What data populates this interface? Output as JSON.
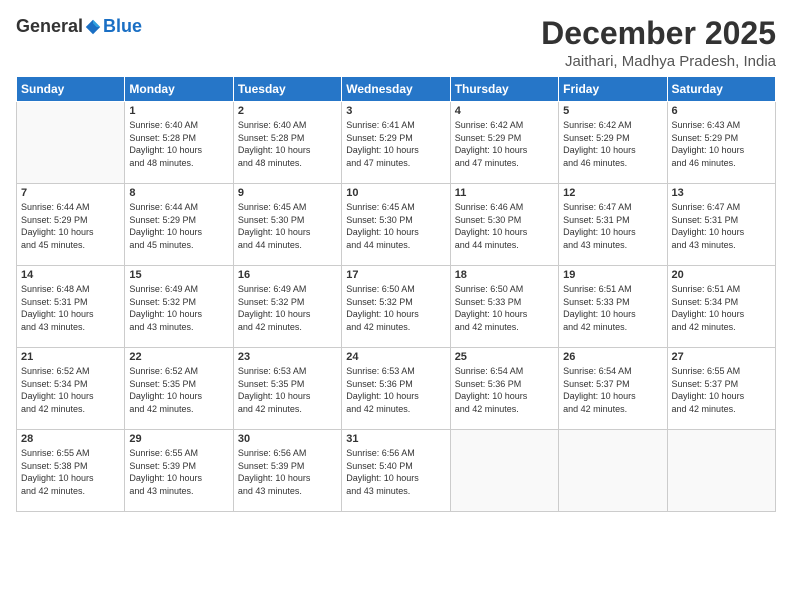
{
  "logo": {
    "general": "General",
    "blue": "Blue"
  },
  "header": {
    "month": "December 2025",
    "location": "Jaithari, Madhya Pradesh, India"
  },
  "days_of_week": [
    "Sunday",
    "Monday",
    "Tuesday",
    "Wednesday",
    "Thursday",
    "Friday",
    "Saturday"
  ],
  "weeks": [
    [
      {
        "day": "",
        "info": ""
      },
      {
        "day": "1",
        "info": "Sunrise: 6:40 AM\nSunset: 5:28 PM\nDaylight: 10 hours\nand 48 minutes."
      },
      {
        "day": "2",
        "info": "Sunrise: 6:40 AM\nSunset: 5:28 PM\nDaylight: 10 hours\nand 48 minutes."
      },
      {
        "day": "3",
        "info": "Sunrise: 6:41 AM\nSunset: 5:29 PM\nDaylight: 10 hours\nand 47 minutes."
      },
      {
        "day": "4",
        "info": "Sunrise: 6:42 AM\nSunset: 5:29 PM\nDaylight: 10 hours\nand 47 minutes."
      },
      {
        "day": "5",
        "info": "Sunrise: 6:42 AM\nSunset: 5:29 PM\nDaylight: 10 hours\nand 46 minutes."
      },
      {
        "day": "6",
        "info": "Sunrise: 6:43 AM\nSunset: 5:29 PM\nDaylight: 10 hours\nand 46 minutes."
      }
    ],
    [
      {
        "day": "7",
        "info": "Sunrise: 6:44 AM\nSunset: 5:29 PM\nDaylight: 10 hours\nand 45 minutes."
      },
      {
        "day": "8",
        "info": "Sunrise: 6:44 AM\nSunset: 5:29 PM\nDaylight: 10 hours\nand 45 minutes."
      },
      {
        "day": "9",
        "info": "Sunrise: 6:45 AM\nSunset: 5:30 PM\nDaylight: 10 hours\nand 44 minutes."
      },
      {
        "day": "10",
        "info": "Sunrise: 6:45 AM\nSunset: 5:30 PM\nDaylight: 10 hours\nand 44 minutes."
      },
      {
        "day": "11",
        "info": "Sunrise: 6:46 AM\nSunset: 5:30 PM\nDaylight: 10 hours\nand 44 minutes."
      },
      {
        "day": "12",
        "info": "Sunrise: 6:47 AM\nSunset: 5:31 PM\nDaylight: 10 hours\nand 43 minutes."
      },
      {
        "day": "13",
        "info": "Sunrise: 6:47 AM\nSunset: 5:31 PM\nDaylight: 10 hours\nand 43 minutes."
      }
    ],
    [
      {
        "day": "14",
        "info": "Sunrise: 6:48 AM\nSunset: 5:31 PM\nDaylight: 10 hours\nand 43 minutes."
      },
      {
        "day": "15",
        "info": "Sunrise: 6:49 AM\nSunset: 5:32 PM\nDaylight: 10 hours\nand 43 minutes."
      },
      {
        "day": "16",
        "info": "Sunrise: 6:49 AM\nSunset: 5:32 PM\nDaylight: 10 hours\nand 42 minutes."
      },
      {
        "day": "17",
        "info": "Sunrise: 6:50 AM\nSunset: 5:32 PM\nDaylight: 10 hours\nand 42 minutes."
      },
      {
        "day": "18",
        "info": "Sunrise: 6:50 AM\nSunset: 5:33 PM\nDaylight: 10 hours\nand 42 minutes."
      },
      {
        "day": "19",
        "info": "Sunrise: 6:51 AM\nSunset: 5:33 PM\nDaylight: 10 hours\nand 42 minutes."
      },
      {
        "day": "20",
        "info": "Sunrise: 6:51 AM\nSunset: 5:34 PM\nDaylight: 10 hours\nand 42 minutes."
      }
    ],
    [
      {
        "day": "21",
        "info": "Sunrise: 6:52 AM\nSunset: 5:34 PM\nDaylight: 10 hours\nand 42 minutes."
      },
      {
        "day": "22",
        "info": "Sunrise: 6:52 AM\nSunset: 5:35 PM\nDaylight: 10 hours\nand 42 minutes."
      },
      {
        "day": "23",
        "info": "Sunrise: 6:53 AM\nSunset: 5:35 PM\nDaylight: 10 hours\nand 42 minutes."
      },
      {
        "day": "24",
        "info": "Sunrise: 6:53 AM\nSunset: 5:36 PM\nDaylight: 10 hours\nand 42 minutes."
      },
      {
        "day": "25",
        "info": "Sunrise: 6:54 AM\nSunset: 5:36 PM\nDaylight: 10 hours\nand 42 minutes."
      },
      {
        "day": "26",
        "info": "Sunrise: 6:54 AM\nSunset: 5:37 PM\nDaylight: 10 hours\nand 42 minutes."
      },
      {
        "day": "27",
        "info": "Sunrise: 6:55 AM\nSunset: 5:37 PM\nDaylight: 10 hours\nand 42 minutes."
      }
    ],
    [
      {
        "day": "28",
        "info": "Sunrise: 6:55 AM\nSunset: 5:38 PM\nDaylight: 10 hours\nand 42 minutes."
      },
      {
        "day": "29",
        "info": "Sunrise: 6:55 AM\nSunset: 5:39 PM\nDaylight: 10 hours\nand 43 minutes."
      },
      {
        "day": "30",
        "info": "Sunrise: 6:56 AM\nSunset: 5:39 PM\nDaylight: 10 hours\nand 43 minutes."
      },
      {
        "day": "31",
        "info": "Sunrise: 6:56 AM\nSunset: 5:40 PM\nDaylight: 10 hours\nand 43 minutes."
      },
      {
        "day": "",
        "info": ""
      },
      {
        "day": "",
        "info": ""
      },
      {
        "day": "",
        "info": ""
      }
    ]
  ]
}
